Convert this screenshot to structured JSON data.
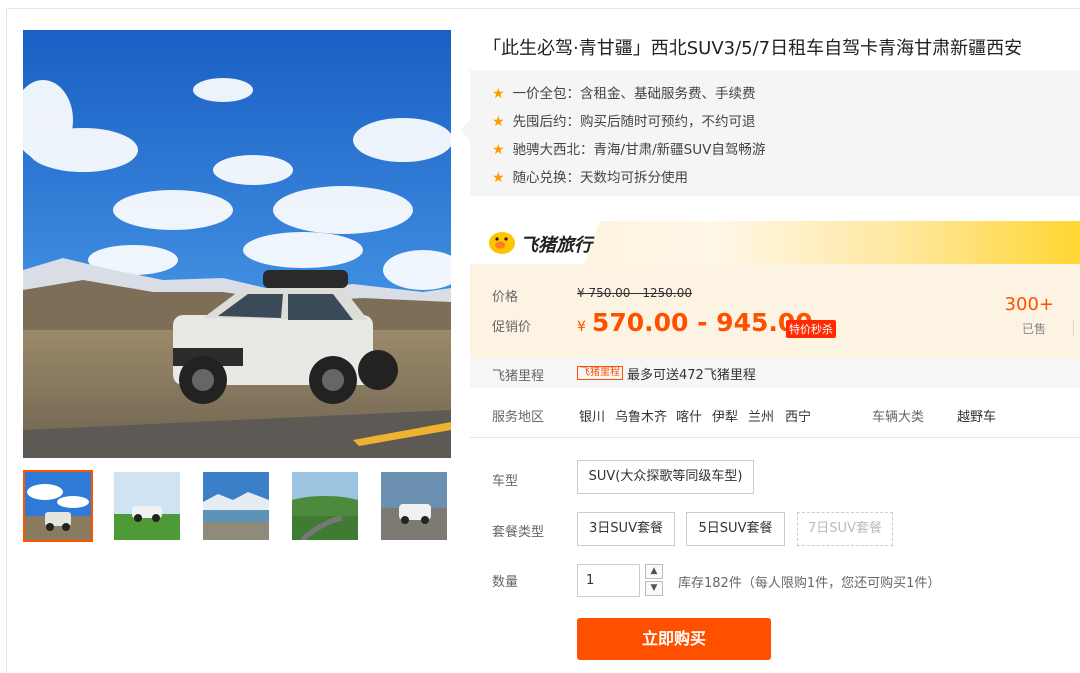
{
  "product": {
    "title": "「此生必驾·青甘疆」西北SUV3/5/7日租车自驾卡青海甘肃新疆西安",
    "features": [
      "一价全包：含租金、基础服务费、手续费",
      "先囤后约：购买后随时可预约，不约可退",
      "驰骋大西北：青海/甘肃/新疆SUV自驾畅游",
      "随心兑换：天数均可拆分使用"
    ]
  },
  "brand": {
    "name": "飞猪旅行",
    "logo_icon": "fliggy-pig-icon"
  },
  "price": {
    "price_label": "价格",
    "original": "¥ 750.00 - 1250.00",
    "promo_label": "促销价",
    "promo_currency": "¥",
    "promo_value": "570.00 - 945.00",
    "promo_tag": "特价秒杀",
    "sold_count": "300+",
    "sold_label": "已售"
  },
  "mileage": {
    "label": "飞猪里程",
    "tag": "飞猪里程",
    "text": "最多可送472飞猪里程"
  },
  "service": {
    "label": "服务地区",
    "cities": [
      "银川",
      "乌鲁木齐",
      "喀什",
      "伊犁",
      "兰州",
      "西宁"
    ],
    "category_label": "车辆大类",
    "category_value": "越野车"
  },
  "options": {
    "car_label": "车型",
    "car_value": "SUV(大众探歌等同级车型)",
    "package_label": "套餐类型",
    "packages": [
      "3日SUV套餐",
      "5日SUV套餐",
      "7日SUV套餐"
    ],
    "qty_label": "数量",
    "qty_value": "1",
    "stock_text": "库存182件（每人限购1件，您还可购买1件）",
    "up_icon": "chevron-up-icon",
    "down_icon": "chevron-down-icon"
  },
  "buy": {
    "label": "立即购买"
  },
  "colors": {
    "accent": "#ff5000",
    "star": "#ff9900",
    "brand_yellow": "#ffd633"
  }
}
